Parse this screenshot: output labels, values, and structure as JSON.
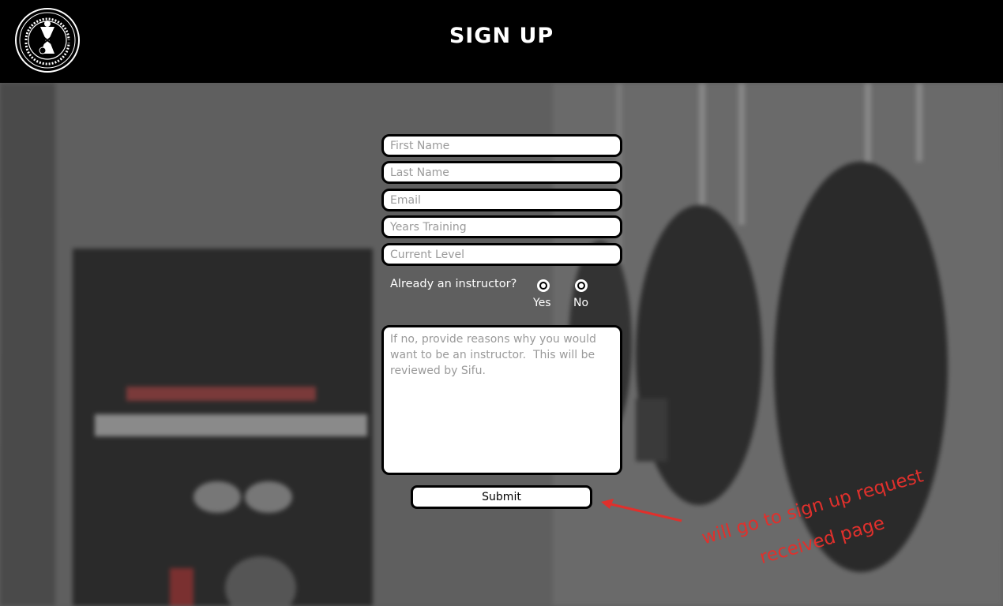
{
  "header": {
    "title": "SIGN UP",
    "logo_text": "WAN KAM LEUNG PRACTICAL WING CHUN KUNG FU INT'L"
  },
  "form": {
    "first_name": {
      "placeholder": "First Name",
      "value": ""
    },
    "last_name": {
      "placeholder": "Last Name",
      "value": ""
    },
    "email": {
      "placeholder": "Email",
      "value": ""
    },
    "years_training": {
      "placeholder": "Years Training",
      "value": ""
    },
    "current_level": {
      "placeholder": "Current Level",
      "value": ""
    },
    "instructor_question": "Already an instructor?",
    "options": {
      "yes": "Yes",
      "no": "No"
    },
    "reasons_placeholder": "If no, provide reasons why you would want to be an instructor.  This will be reviewed by Sifu.",
    "submit_label": "Submit"
  },
  "annotation": {
    "text": "will go to sign up request received page",
    "color": "#e0302c"
  },
  "colors": {
    "header_bg": "#000000",
    "field_bg": "#ffffff",
    "accent_red": "#e0302c"
  }
}
